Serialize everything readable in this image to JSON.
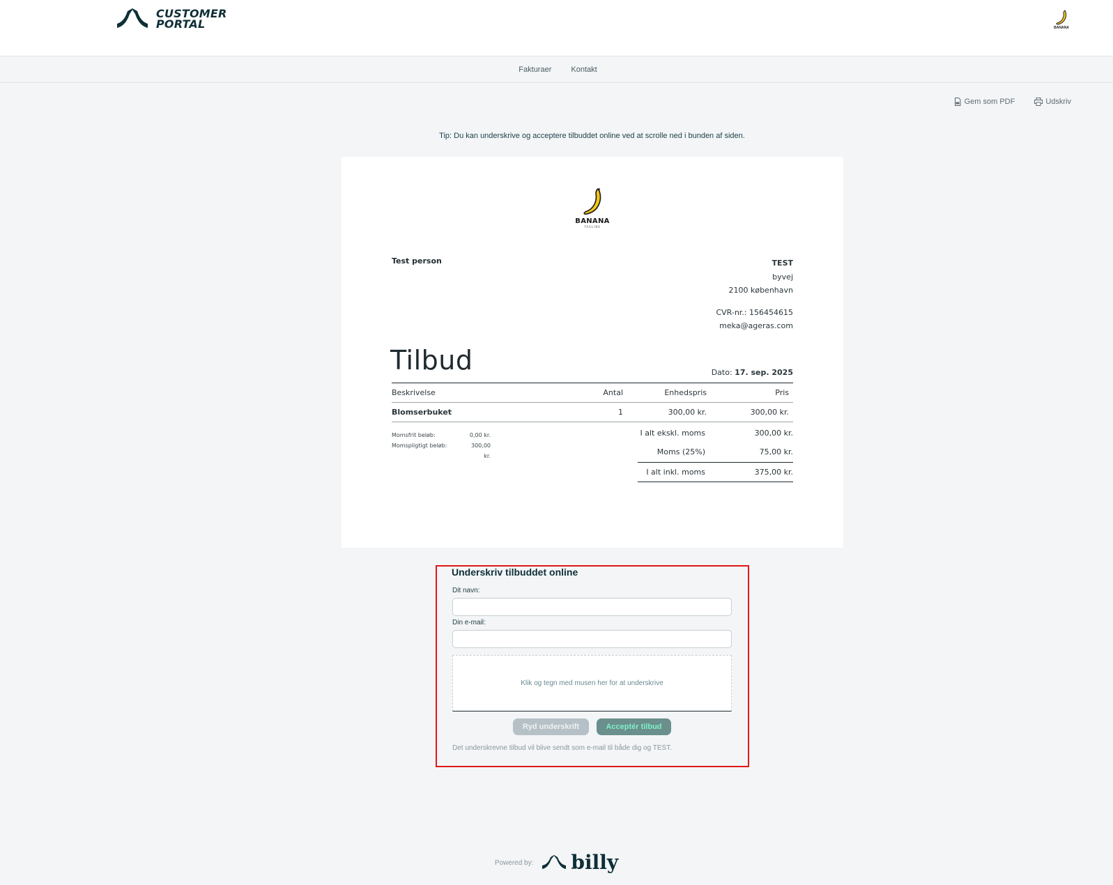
{
  "header": {
    "brand_line1": "CUSTOMER",
    "brand_line2": "PORTAL",
    "company_logo_text": "BANANA"
  },
  "nav": {
    "items": [
      "Fakturaer",
      "Kontakt"
    ]
  },
  "actions": {
    "pdf_label": "Gem som PDF",
    "print_label": "Udskriv"
  },
  "tip": "Tip: Du kan underskrive og acceptere tilbuddet online ved at scrolle ned i bunden af siden.",
  "document": {
    "logo_name": "BANANA",
    "logo_tagline": "TAGLINE",
    "customer_name": "Test person",
    "company": {
      "name": "TEST",
      "street": "byvej",
      "city": "2100 københavn",
      "cvr": "CVR-nr.: 156454615",
      "email": "meka@ageras.com"
    },
    "title": "Tilbud",
    "date_label": "Dato:",
    "date_value": "17. sep. 2025",
    "columns": {
      "description": "Beskrivelse",
      "qty": "Antal",
      "unit_price": "Enhedspris",
      "price": "Pris"
    },
    "lines": [
      {
        "description": "Blomserbuket",
        "qty": "1",
        "unit_price": "300,00 kr.",
        "price": "300,00 kr."
      }
    ],
    "vat_info": {
      "exempt_label": "Momsfrit beløb:",
      "exempt_value": "0,00 kr.",
      "taxable_label": "Momspligtigt beløb:",
      "taxable_value": "300,00 kr."
    },
    "totals": {
      "excl_label": "I alt ekskl. moms",
      "excl_value": "300,00 kr.",
      "vat_label": "Moms (25%)",
      "vat_value": "75,00 kr.",
      "incl_label": "I alt inkl. moms",
      "incl_value": "375,00 kr."
    }
  },
  "signature": {
    "title": "Underskriv tilbuddet online",
    "name_label": "Dit navn:",
    "name_value": "",
    "email_label": "Din e-mail:",
    "email_value": "",
    "pad_hint": "Klik og tegn med musen her for at underskrive",
    "clear_button": "Ryd underskrift",
    "accept_button": "Acceptér tilbud",
    "note": "Det underskrevne tilbud vil blive sendt som e-mail til både dig og TEST."
  },
  "footer": {
    "powered_by": "Powered by:",
    "brand": "billy"
  },
  "colors": {
    "brand_dark": "#0f2f37",
    "accept_bg": "#6a8f8c",
    "accept_text": "#7ff0c7",
    "highlight": "#e01818"
  }
}
